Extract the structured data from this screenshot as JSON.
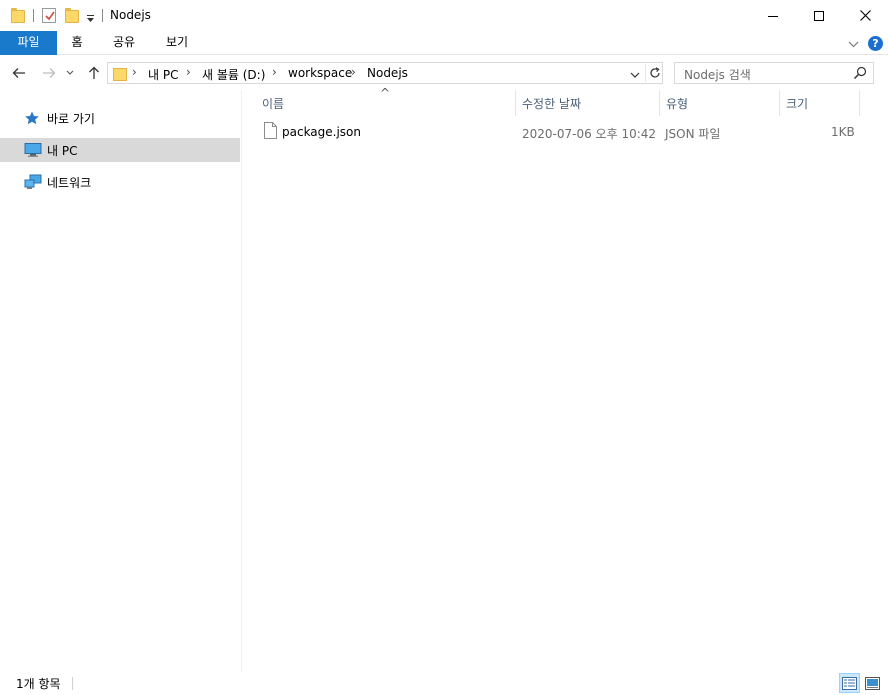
{
  "window": {
    "title": "Nodejs"
  },
  "ribbon": {
    "tabs": [
      {
        "label": "파일"
      },
      {
        "label": "홈"
      },
      {
        "label": "공유"
      },
      {
        "label": "보기"
      }
    ],
    "help_label": "?"
  },
  "address": {
    "crumbs": [
      "내 PC",
      "새 볼륨 (D:)",
      "workspace",
      "Nodejs"
    ]
  },
  "search": {
    "placeholder": "Nodejs 검색"
  },
  "nav_pane": {
    "items": [
      {
        "label": "바로 가기",
        "icon": "star-icon",
        "selected": false
      },
      {
        "label": "내 PC",
        "icon": "computer-icon",
        "selected": true
      },
      {
        "label": "네트워크",
        "icon": "network-icon",
        "selected": false
      }
    ]
  },
  "columns": [
    {
      "label": "이름"
    },
    {
      "label": "수정한 날짜"
    },
    {
      "label": "유형"
    },
    {
      "label": "크기"
    }
  ],
  "sort": {
    "column": "이름",
    "direction": "ascending"
  },
  "files": [
    {
      "name": "package.json",
      "modified": "2020-07-06 오후 10:42",
      "type": "JSON 파일",
      "size": "1KB",
      "icon": "document-icon"
    }
  ],
  "status": {
    "item_count": "1개 항목"
  },
  "colors": {
    "accent": "#1979ca",
    "selected_nav": "#d9d9d9",
    "header_text": "#4c607a"
  }
}
